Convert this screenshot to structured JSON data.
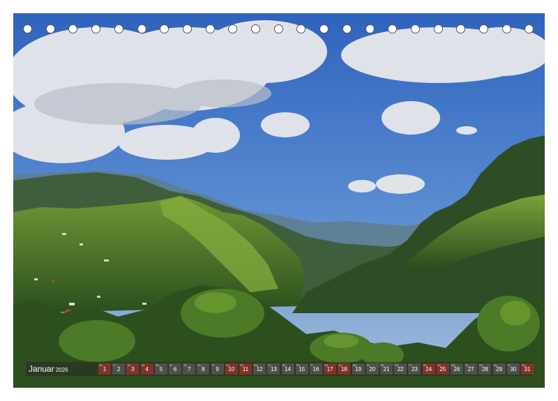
{
  "photo": {
    "subject": "mountain-valley-landscape",
    "colors": {
      "sky": "#3f74c6",
      "cloud": "#e8e8ea",
      "forest": "#2f5a22",
      "grass": "#6f9a34"
    }
  },
  "calendar": {
    "month": "Januar",
    "year": "2026",
    "days": [
      {
        "n": "1",
        "wd": "Do",
        "red": true
      },
      {
        "n": "2",
        "wd": "Fr",
        "red": false
      },
      {
        "n": "3",
        "wd": "Sa",
        "red": true
      },
      {
        "n": "4",
        "wd": "So",
        "red": true
      },
      {
        "n": "5",
        "wd": "Mo",
        "red": false
      },
      {
        "n": "6",
        "wd": "Di",
        "red": false
      },
      {
        "n": "7",
        "wd": "Mi",
        "red": false
      },
      {
        "n": "8",
        "wd": "Do",
        "red": false
      },
      {
        "n": "9",
        "wd": "Fr",
        "red": false
      },
      {
        "n": "10",
        "wd": "Sa",
        "red": true
      },
      {
        "n": "11",
        "wd": "So",
        "red": true
      },
      {
        "n": "12",
        "wd": "Mo",
        "red": false
      },
      {
        "n": "13",
        "wd": "Di",
        "red": false
      },
      {
        "n": "14",
        "wd": "Mi",
        "red": false
      },
      {
        "n": "15",
        "wd": "Do",
        "red": false
      },
      {
        "n": "16",
        "wd": "Fr",
        "red": false
      },
      {
        "n": "17",
        "wd": "Sa",
        "red": true
      },
      {
        "n": "18",
        "wd": "So",
        "red": true
      },
      {
        "n": "19",
        "wd": "Mo",
        "red": false
      },
      {
        "n": "20",
        "wd": "Di",
        "red": false
      },
      {
        "n": "21",
        "wd": "Mi",
        "red": false
      },
      {
        "n": "22",
        "wd": "Do",
        "red": false
      },
      {
        "n": "23",
        "wd": "Fr",
        "red": false
      },
      {
        "n": "24",
        "wd": "Sa",
        "red": true
      },
      {
        "n": "25",
        "wd": "So",
        "red": true
      },
      {
        "n": "26",
        "wd": "Mo",
        "red": false
      },
      {
        "n": "27",
        "wd": "Di",
        "red": false
      },
      {
        "n": "28",
        "wd": "Mi",
        "red": false
      },
      {
        "n": "29",
        "wd": "Do",
        "red": false
      },
      {
        "n": "30",
        "wd": "Fr",
        "red": false
      },
      {
        "n": "31",
        "wd": "Sa",
        "red": true
      }
    ]
  }
}
